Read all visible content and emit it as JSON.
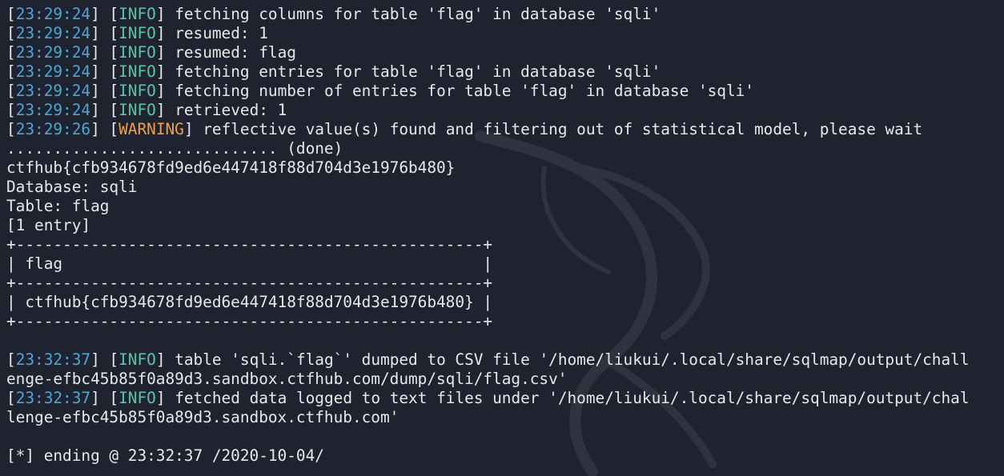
{
  "terminal": {
    "background": "#1f2330",
    "text_color": "#e8e8e8",
    "timestamp_color": "#4fa6d6",
    "info_color": "#5cc2a8",
    "warning_color": "#f0a046",
    "watermark": "kali-dragon-logo",
    "lines": [
      {
        "type": "log",
        "time": "23:29:24",
        "level": "INFO",
        "message": "fetching columns for table 'flag' in database 'sqli'"
      },
      {
        "type": "log",
        "time": "23:29:24",
        "level": "INFO",
        "message": "resumed: 1"
      },
      {
        "type": "log",
        "time": "23:29:24",
        "level": "INFO",
        "message": "resumed: flag"
      },
      {
        "type": "log",
        "time": "23:29:24",
        "level": "INFO",
        "message": "fetching entries for table 'flag' in database 'sqli'"
      },
      {
        "type": "log",
        "time": "23:29:24",
        "level": "INFO",
        "message": "fetching number of entries for table 'flag' in database 'sqli'"
      },
      {
        "type": "log",
        "time": "23:29:24",
        "level": "INFO",
        "message": "retrieved: 1"
      },
      {
        "type": "log",
        "time": "23:29:26",
        "level": "WARNING",
        "message": "reflective value(s) found and filtering out of statistical model, please wait"
      },
      {
        "type": "text",
        "text": "............................. (done)"
      },
      {
        "type": "text",
        "text": "ctfhub{cfb934678fd9ed6e447418f88d704d3e1976b480}"
      },
      {
        "type": "text",
        "text": "Database: sqli"
      },
      {
        "type": "text",
        "text": "Table: flag"
      },
      {
        "type": "text",
        "text": "[1 entry]"
      },
      {
        "type": "text",
        "text": "+--------------------------------------------------+"
      },
      {
        "type": "text",
        "text": "| flag                                             |"
      },
      {
        "type": "text",
        "text": "+--------------------------------------------------+"
      },
      {
        "type": "text",
        "text": "| ctfhub{cfb934678fd9ed6e447418f88d704d3e1976b480} |"
      },
      {
        "type": "text",
        "text": "+--------------------------------------------------+"
      },
      {
        "type": "text",
        "text": ""
      },
      {
        "type": "log",
        "time": "23:32:37",
        "level": "INFO",
        "message": "table 'sqli.`flag`' dumped to CSV file '/home/liukui/.local/share/sqlmap/output/chall"
      },
      {
        "type": "text",
        "text": "enge-efbc45b85f0a89d3.sandbox.ctfhub.com/dump/sqli/flag.csv'"
      },
      {
        "type": "log",
        "time": "23:32:37",
        "level": "INFO",
        "message": "fetched data logged to text files under '/home/liukui/.local/share/sqlmap/output/chal"
      },
      {
        "type": "text",
        "text": "lenge-efbc45b85f0a89d3.sandbox.ctfhub.com'"
      },
      {
        "type": "text",
        "text": ""
      },
      {
        "type": "text",
        "text": "[*] ending @ 23:32:37 /2020-10-04/"
      }
    ]
  }
}
